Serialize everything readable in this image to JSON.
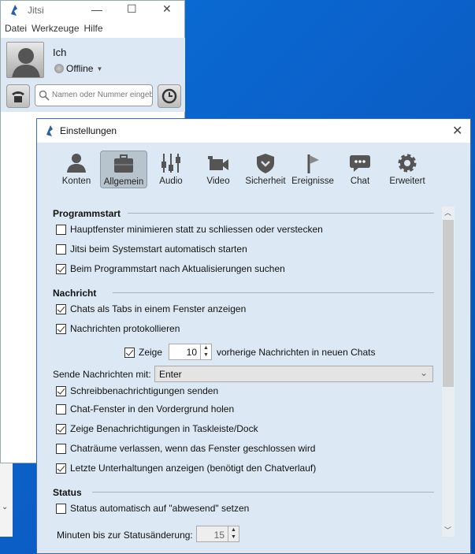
{
  "main_window": {
    "title": "Jitsi",
    "menu": [
      "Datei",
      "Werkzeuge",
      "Hilfe"
    ],
    "user_name": "Ich",
    "status": "Offline",
    "search_placeholder": "Namen oder Nummer eingeben"
  },
  "dialog": {
    "title": "Einstellungen",
    "tabs": [
      {
        "label": "Konten",
        "icon": "person-icon"
      },
      {
        "label": "Allgemein",
        "icon": "briefcase-icon",
        "selected": true
      },
      {
        "label": "Audio",
        "icon": "sliders-icon"
      },
      {
        "label": "Video",
        "icon": "camera-icon"
      },
      {
        "label": "Sicherheit",
        "icon": "shield-icon"
      },
      {
        "label": "Ereignisse",
        "icon": "flag-icon"
      },
      {
        "label": "Chat",
        "icon": "chat-bubble-icon"
      },
      {
        "label": "Erweitert",
        "icon": "gear-icon"
      }
    ],
    "sections": {
      "programmstart": {
        "title": "Programmstart",
        "options": [
          {
            "label": "Hauptfenster minimieren statt zu schliessen oder verstecken",
            "checked": false
          },
          {
            "label": "Jitsi beim Systemstart automatisch starten",
            "checked": false
          },
          {
            "label": "Beim Programmstart nach Aktualisierungen suchen",
            "checked": true
          }
        ]
      },
      "nachricht": {
        "title": "Nachricht",
        "options": [
          {
            "label": "Chats als Tabs in einem Fenster anzeigen",
            "checked": true
          },
          {
            "label": "Nachrichten protokollieren",
            "checked": true
          }
        ],
        "history": {
          "label": "Zeige",
          "checked": true,
          "value": "10",
          "suffix": "vorherige Nachrichten in neuen Chats"
        },
        "send_label": "Sende Nachrichten mit:",
        "send_value": "Enter",
        "options2": [
          {
            "label": "Schreibbenachrichtigungen senden",
            "checked": true
          },
          {
            "label": "Chat-Fenster in den Vordergrund holen",
            "checked": false
          },
          {
            "label": "Zeige Benachrichtigungen in Taskleiste/Dock",
            "checked": true
          },
          {
            "label": "Chaträume verlassen, wenn das Fenster geschlossen wird",
            "checked": false
          },
          {
            "label": "Letzte Unterhaltungen anzeigen (benötigt den Chatverlauf)",
            "checked": true
          }
        ]
      },
      "status": {
        "title": "Status",
        "options": [
          {
            "label": "Status automatisch auf \"abwesend\" setzen",
            "checked": false
          }
        ],
        "minutes_label": "Minuten bis zur Statusänderung:",
        "minutes_value": "15"
      }
    }
  }
}
